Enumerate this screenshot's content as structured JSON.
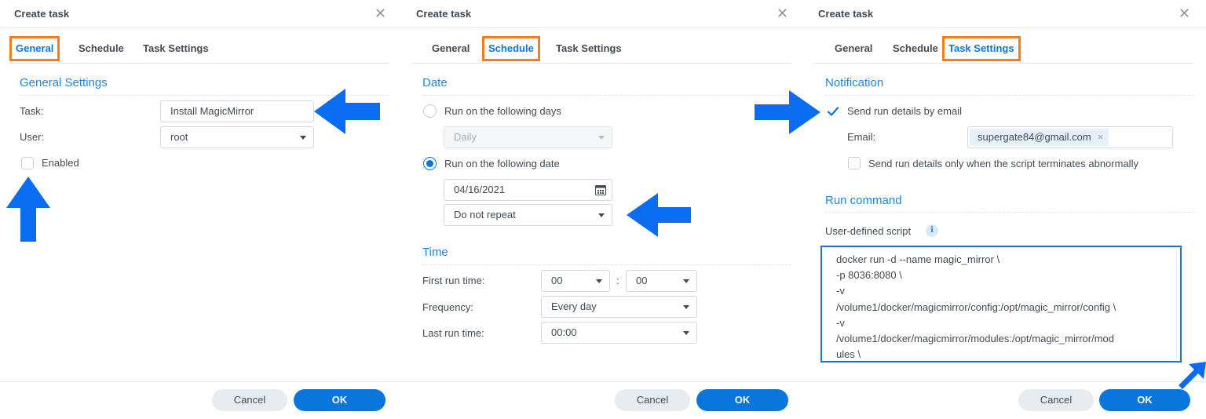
{
  "dialog_title": "Create task",
  "close_glyph": "✕",
  "tabs": {
    "general": "General",
    "schedule": "Schedule",
    "task_settings": "Task Settings"
  },
  "highlight_color": "#f57c1f",
  "accent_color": "#0a76dd",
  "arrow_color": "#0a6cf0",
  "buttons": {
    "cancel": "Cancel",
    "ok": "OK"
  },
  "general": {
    "section": "General Settings",
    "task_label": "Task:",
    "task_value": "Install MagicMirror",
    "user_label": "User:",
    "user_value": "root",
    "enabled_label": "Enabled",
    "enabled_checked": false
  },
  "schedule": {
    "date_section": "Date",
    "days_option": "Run on the following days",
    "days_value": "Daily",
    "date_option": "Run on the following date",
    "date_value": "04/16/2021",
    "repeat_value": "Do not repeat",
    "selected_option": "date",
    "time_section": "Time",
    "first_run_label": "First run time:",
    "first_run_hour": "00",
    "time_sep": ":",
    "first_run_minute": "00",
    "frequency_label": "Frequency:",
    "frequency_value": "Every day",
    "last_run_label": "Last run time:",
    "last_run_value": "00:00"
  },
  "task_settings": {
    "notification_section": "Notification",
    "send_email_label": "Send run details by email",
    "send_email_checked": true,
    "email_label": "Email:",
    "email_tag": "supergate84@gmail.com",
    "tag_remove": "×",
    "abnormal_label": "Send run details only when the script terminates abnormally",
    "abnormal_checked": false,
    "run_command_section": "Run command",
    "script_label": "User-defined script",
    "info_glyph": "i",
    "script_lines": [
      "docker run -d --name magic_mirror \\",
      "-p 8036:8080 \\",
      "-v",
      "/volume1/docker/magicmirror/config:/opt/magic_mirror/config \\",
      "-v",
      "/volume1/docker/magicmirror/modules:/opt/magic_mirror/mod",
      "ules \\"
    ]
  }
}
